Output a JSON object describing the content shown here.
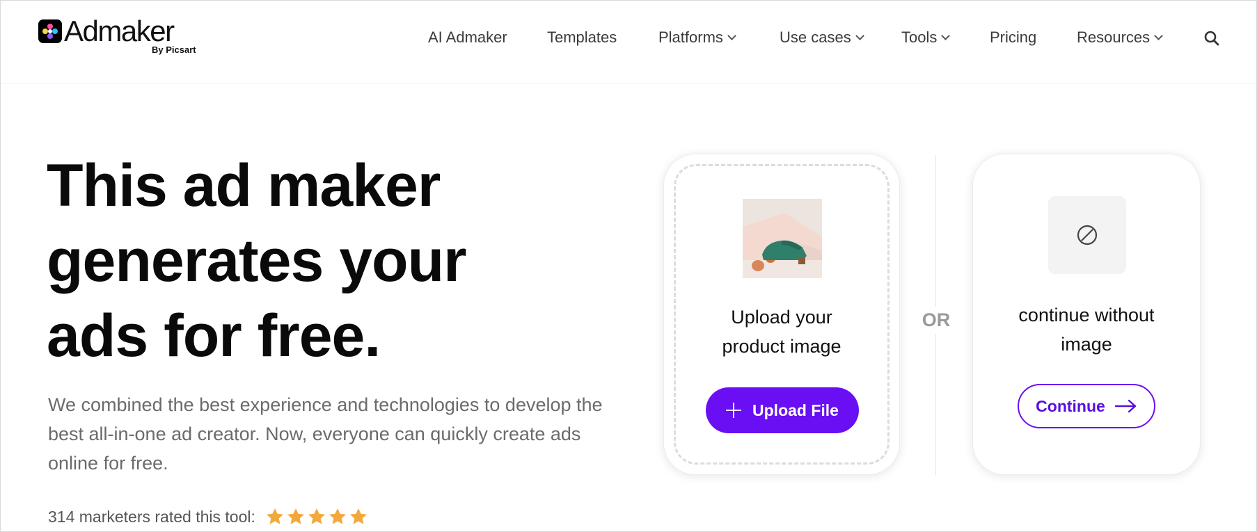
{
  "header": {
    "logo_text": "Admaker",
    "logo_sub": "By Picsart",
    "nav": [
      {
        "label": "AI Admaker",
        "dropdown": false
      },
      {
        "label": "Templates",
        "dropdown": false
      },
      {
        "label": "Platforms",
        "dropdown": true
      },
      {
        "label": "Use cases",
        "dropdown": true
      },
      {
        "label": "Tools",
        "dropdown": true
      },
      {
        "label": "Pricing",
        "dropdown": false
      },
      {
        "label": "Resources",
        "dropdown": true
      }
    ],
    "search_icon": "search-icon"
  },
  "hero": {
    "title_lines": [
      "This ad maker",
      "generates your",
      "ads for free."
    ],
    "description": "We combined the best experience and technologies to develop the best all-in-one ad creator. Now, everyone can quickly create ads online for free.",
    "rating_text": "314 marketers rated this tool:",
    "rating_stars": 5,
    "star_color": "#f2a93b"
  },
  "upload_card": {
    "label_line1": "Upload your",
    "label_line2": "product image",
    "button_label": "Upload File",
    "button_icon": "plus-icon"
  },
  "separator": {
    "or_text": "OR"
  },
  "continue_card": {
    "label_line1": "continue without",
    "label_line2": "image",
    "button_label": "Continue",
    "button_icon": "arrow-right-icon",
    "placeholder_icon": "no-image-icon"
  },
  "colors": {
    "accent": "#6a0ff3",
    "text_dark": "#0a0a0a",
    "text_muted": "#6b6b6b"
  }
}
